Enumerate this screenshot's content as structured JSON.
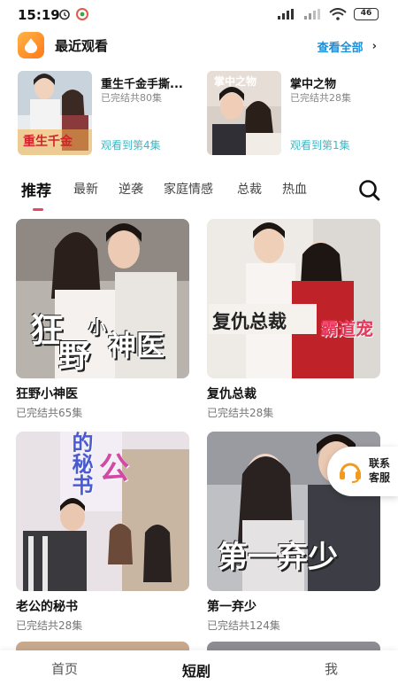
{
  "status_bar": {
    "time": "15:19",
    "battery": "46"
  },
  "recent": {
    "title": "最近观看",
    "view_all": "查看全部",
    "items": [
      {
        "name": "重生千金手撕...",
        "episodes": "已完结共80集",
        "progress": "观看到第4集"
      },
      {
        "name": "掌中之物",
        "episodes": "已完结共28集",
        "progress": "观看到第1集"
      }
    ]
  },
  "tabs": [
    "推荐",
    "最新",
    "逆袭",
    "家庭情感",
    "总裁",
    "热血"
  ],
  "grid": [
    {
      "title": "狂野小神医",
      "episodes": "已完结共65集",
      "poster_text_1": "狂",
      "poster_text_2": "小",
      "poster_text_3": "野",
      "poster_text_4": "神医"
    },
    {
      "title": "复仇总裁",
      "episodes": "已完结共28集",
      "poster_text_1": "复仇总裁",
      "poster_text_2": "霸道宠"
    },
    {
      "title": "老公的秘书",
      "episodes": "已完结共28集",
      "poster_text_1": "的秘书",
      "poster_text_2": "公"
    },
    {
      "title": "第一弃少",
      "episodes": "已完结共124集",
      "poster_text_1": "第一弃少"
    }
  ],
  "service": {
    "label": "联系客服"
  },
  "bottom_nav": [
    "首页",
    "短剧",
    "我"
  ],
  "colors": {
    "accent": "#e8475f",
    "link": "#1f8fd8",
    "progress": "#3bb8c4",
    "logo": "#ff8a20"
  }
}
